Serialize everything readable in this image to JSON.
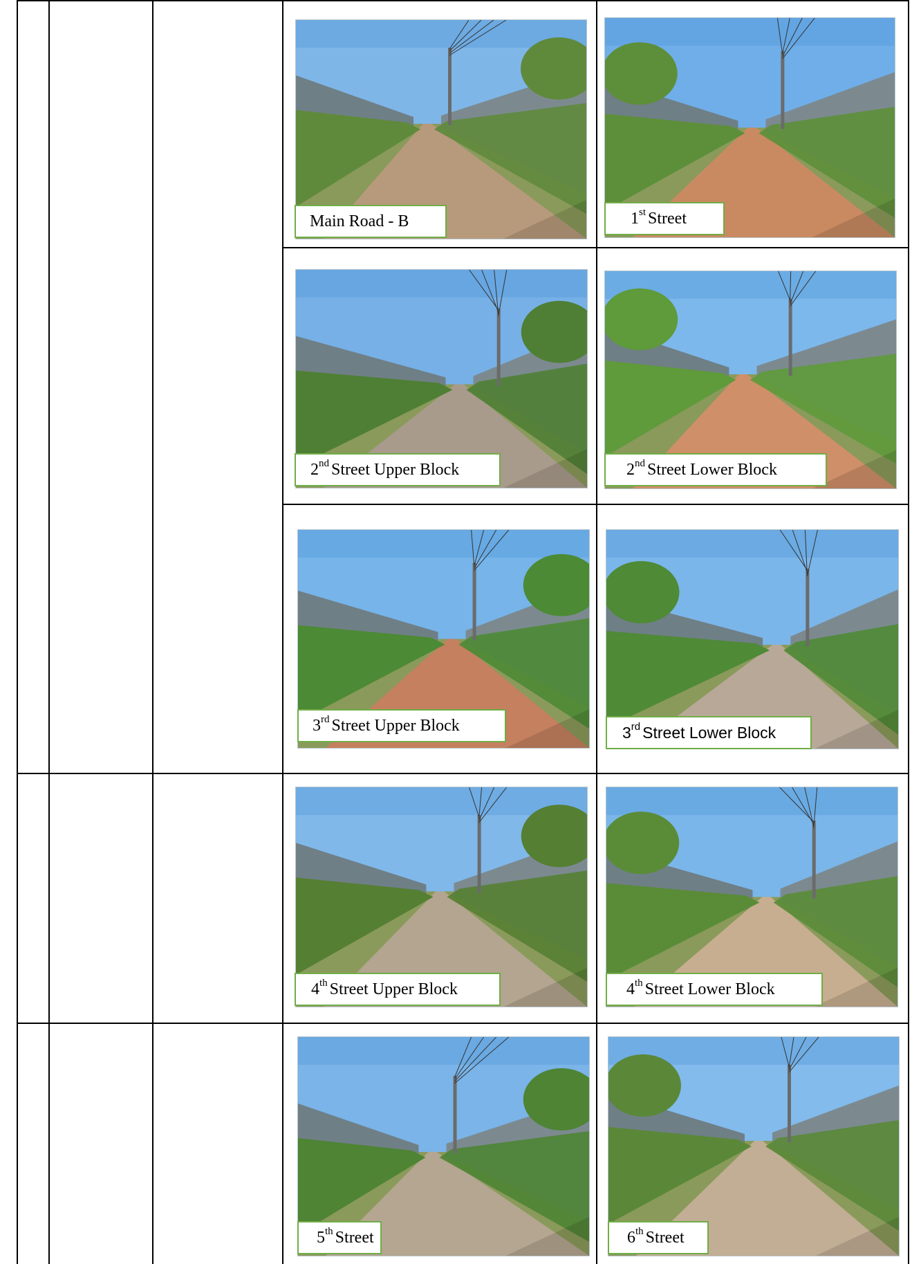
{
  "photos": [
    {
      "id": "main-road-b",
      "caption_num": "",
      "caption_sup": "",
      "caption_text": "Main Road - B",
      "road_color": "#b79a7c",
      "sky_color": "#7fb6e8",
      "foliage_color": "#5f8a3c"
    },
    {
      "id": "1st-street",
      "caption_num": "1",
      "caption_sup": "st",
      "caption_text": "Street",
      "road_color": "#c98a62",
      "sky_color": "#6faee8",
      "foliage_color": "#5d8f3a"
    },
    {
      "id": "2nd-street-upper",
      "caption_num": "2",
      "caption_sup": "nd",
      "caption_text": "Street Upper Block",
      "road_color": "#a89b8b",
      "sky_color": "#76b0e6",
      "foliage_color": "#4f7f34"
    },
    {
      "id": "2nd-street-lower",
      "caption_num": "2",
      "caption_sup": "nd",
      "caption_text": "Street Lower Block",
      "road_color": "#cf8f68",
      "sky_color": "#7cb8ec",
      "foliage_color": "#5f9a3b"
    },
    {
      "id": "3rd-street-upper",
      "caption_num": "3",
      "caption_sup": "rd",
      "caption_text": "Street Upper Block",
      "road_color": "#c4805f",
      "sky_color": "#76b4ea",
      "foliage_color": "#4c8a35"
    },
    {
      "id": "3rd-street-lower",
      "caption_num": "3",
      "caption_sup": "rd",
      "caption_text": "Street Lower Block",
      "road_color": "#b8a898",
      "sky_color": "#7bb6ea",
      "foliage_color": "#4f8a36"
    },
    {
      "id": "4th-street-upper",
      "caption_num": "4",
      "caption_sup": "th",
      "caption_text": "Street Upper Block",
      "road_color": "#b3a58f",
      "sky_color": "#80b8ea",
      "foliage_color": "#557f33"
    },
    {
      "id": "4th-street-lower",
      "caption_num": "4",
      "caption_sup": "th",
      "caption_text": "Street Lower Block",
      "road_color": "#c7ae90",
      "sky_color": "#7ab6ea",
      "foliage_color": "#5a8c38"
    },
    {
      "id": "5th-street",
      "caption_num": "5",
      "caption_sup": "th",
      "caption_text": "Street",
      "road_color": "#b4a690",
      "sky_color": "#7ab4e8",
      "foliage_color": "#4e8434"
    },
    {
      "id": "6th-street",
      "caption_num": "6",
      "caption_sup": "th",
      "caption_text": "Street",
      "road_color": "#c2ae94",
      "sky_color": "#82bbec",
      "foliage_color": "#5a8838"
    }
  ]
}
